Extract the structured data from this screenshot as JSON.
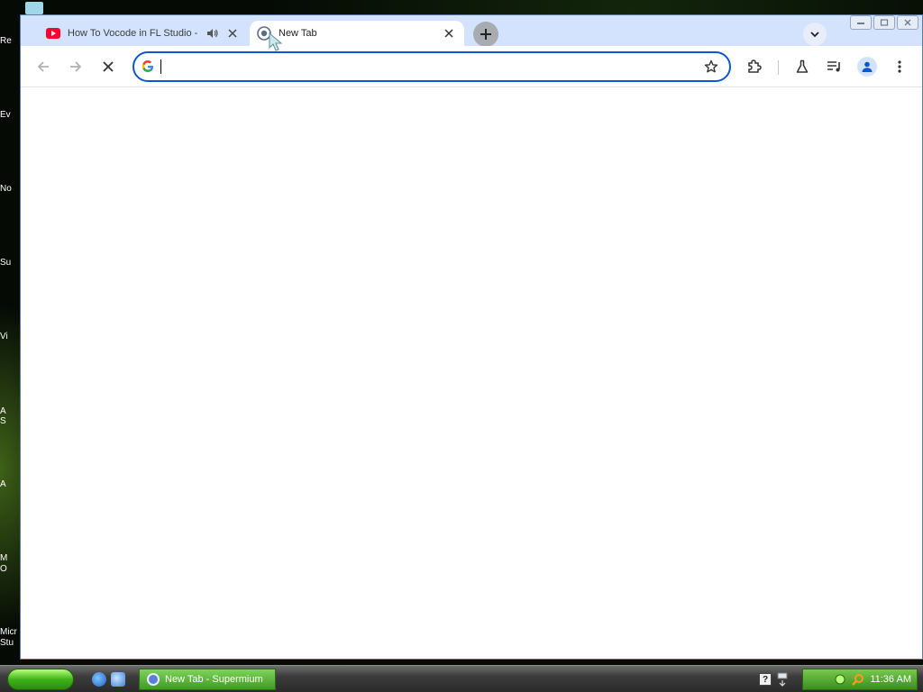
{
  "desktop": {
    "labels": [
      "Re",
      "Ev",
      "No",
      "Su",
      "Vi",
      "A",
      "S",
      "A",
      "M",
      "O",
      "Micr",
      "Stu"
    ]
  },
  "browser": {
    "tabs": [
      {
        "title": "How To Vocode in FL Studio -",
        "favicon": "youtube-icon",
        "audio": "speaker-icon",
        "active": false
      },
      {
        "title": "New Tab",
        "favicon": "supermium-icon",
        "active": true
      }
    ],
    "omnibox": {
      "value": "",
      "placeholder": ""
    },
    "colors": {
      "accent": "#0b57d0",
      "tabstrip": "#d3e3fd",
      "youtube": "#ff0033"
    }
  },
  "taskbar": {
    "task_title": "New Tab - Supermium",
    "clock": "11:36 AM",
    "help_glyph": "?"
  }
}
